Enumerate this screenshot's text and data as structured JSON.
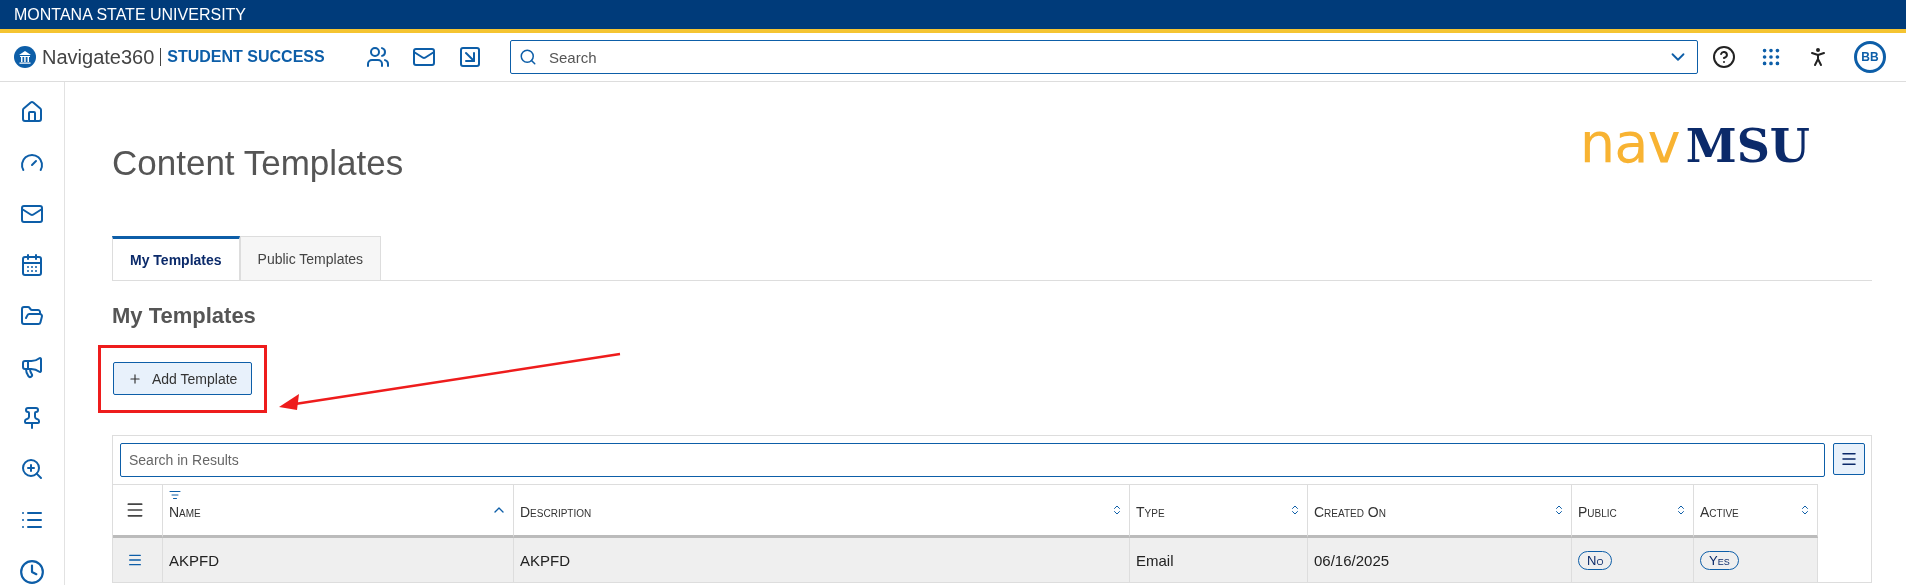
{
  "top_banner": {
    "title": "MONTANA STATE UNIVERSITY"
  },
  "header": {
    "brand": "Navigate360",
    "product": "STUDENT SUCCESS",
    "search": {
      "placeholder": "Search"
    },
    "avatar": "BB"
  },
  "page": {
    "title": "Content Templates",
    "logo": {
      "left": "nav",
      "right": "MSU"
    }
  },
  "tabs": [
    {
      "label": "My Templates",
      "selected": true
    },
    {
      "label": "Public Templates",
      "selected": false
    }
  ],
  "section_title": "My Templates",
  "add_button": {
    "label": "Add Template"
  },
  "table": {
    "search": {
      "placeholder": "Search in Results"
    },
    "columns": [
      {
        "label": "Name",
        "sorted": true
      },
      {
        "label": "Description",
        "sorted": false
      },
      {
        "label": "Type",
        "sorted": false
      },
      {
        "label": "Created On",
        "sorted": false
      },
      {
        "label": "Public",
        "sorted": false
      },
      {
        "label": "Active",
        "sorted": false
      }
    ],
    "rows": [
      {
        "cells": [
          {
            "kind": "text",
            "value": "AKPFD"
          },
          {
            "kind": "text",
            "value": "AKPFD"
          },
          {
            "kind": "text",
            "value": "Email"
          },
          {
            "kind": "text",
            "value": "06/16/2025"
          },
          {
            "kind": "pill",
            "value": "No"
          },
          {
            "kind": "pill",
            "value": "Yes"
          }
        ]
      }
    ]
  }
}
